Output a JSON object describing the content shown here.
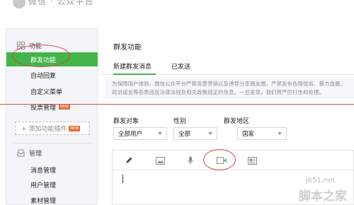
{
  "topbar": {
    "brand": "微信 · 公众平台"
  },
  "sidebar": {
    "section_function": "功能",
    "items_function": [
      {
        "label": "群发功能",
        "active": true
      },
      {
        "label": "自动回复"
      },
      {
        "label": "自定义菜单"
      },
      {
        "label": "投票管理",
        "tag": "NEW"
      }
    ],
    "add_plugin": {
      "label": "+ 添加功能插件",
      "tag": "NEW"
    },
    "section_manage": "管理",
    "items_manage": [
      {
        "label": "消息管理"
      },
      {
        "label": "用户管理"
      },
      {
        "label": "素材管理"
      }
    ]
  },
  "main": {
    "title": "群发功能",
    "tabs": [
      {
        "label": "新建群发消息",
        "active": true
      },
      {
        "label": "已发送"
      }
    ],
    "notice": "为保障用户体验，微信公众平台严禁恶意营销以及诱导分享朋友圈，严禁发布色情低俗、暴力血腥、政治谣言等各类违反法律法规及相关政策规定的信息。一旦发现，我们将严厉打击和处理。",
    "filters": [
      {
        "label": "群发对象",
        "value": "全部用户"
      },
      {
        "label": "性别",
        "value": "全部"
      },
      {
        "label": "群发地区",
        "value": "国家"
      }
    ]
  },
  "editor_tools": [
    "pencil-icon",
    "image-icon",
    "microphone-icon",
    "video-icon",
    "article-icon"
  ],
  "watermark": {
    "site": "jb51.net",
    "brand": "脚本之家"
  },
  "colors": {
    "accent": "#44b549",
    "annotation": "#d24b4b"
  }
}
